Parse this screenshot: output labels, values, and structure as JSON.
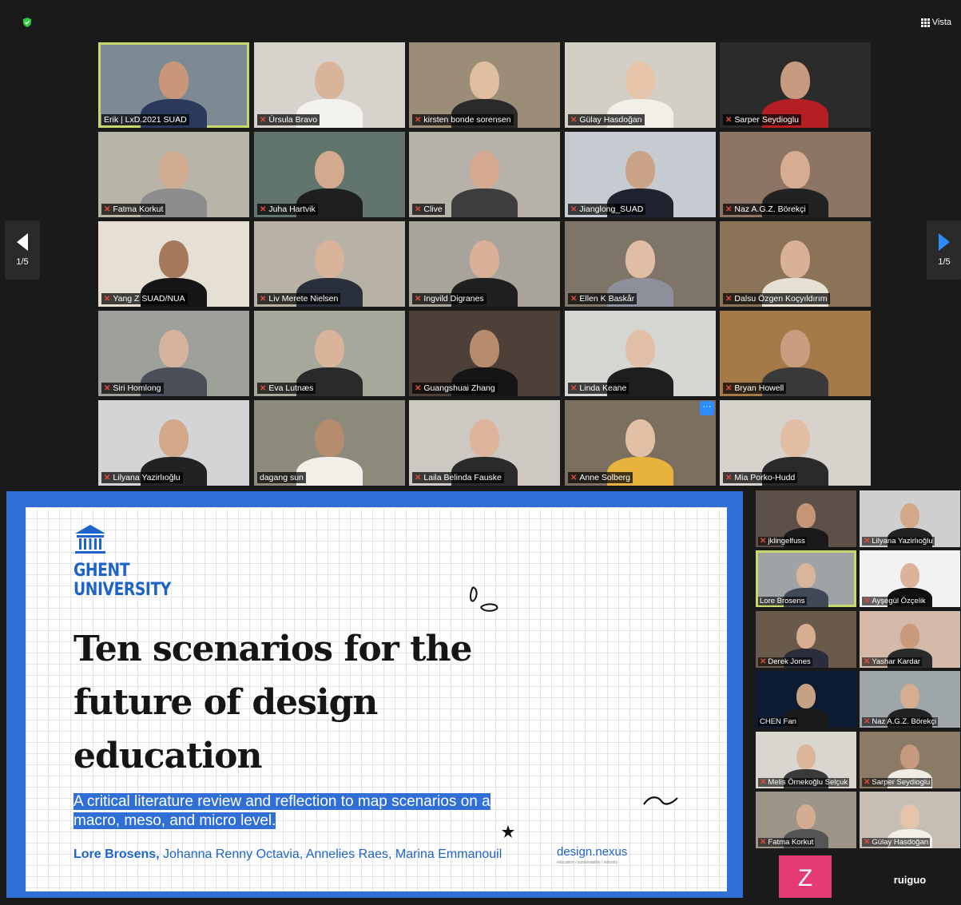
{
  "toolbar": {
    "view_label": "Vista"
  },
  "pagination": {
    "left": "1/5",
    "right": "1/5"
  },
  "gallery": [
    {
      "name": "Erik | LxD.2021 SUAD",
      "muted": false,
      "active": true,
      "bg": "#7e8a93",
      "skin": "#c9967a",
      "shirt": "#2b3a5c"
    },
    {
      "name": "Úrsula Bravo",
      "muted": true,
      "active": false,
      "bg": "#d7d2cc",
      "skin": "#d8b49a",
      "shirt": "#f4f2ef"
    },
    {
      "name": "kirsten bonde sorensen",
      "muted": true,
      "active": false,
      "bg": "#9c8d79",
      "skin": "#e0bfa0",
      "shirt": "#2a2a2a"
    },
    {
      "name": "Gülay Hasdoğan",
      "muted": true,
      "active": false,
      "bg": "#d4cfc5",
      "skin": "#e6c4aa",
      "shirt": "#f2efe9"
    },
    {
      "name": "Sarper Seydioglu",
      "muted": true,
      "active": false,
      "bg": "#2b2b2b",
      "skin": "#c59a7e",
      "shirt": "#b51f24"
    },
    {
      "name": "Fatma Korkut",
      "muted": true,
      "active": false,
      "bg": "#b9b4a8",
      "skin": "#d3ad91",
      "shirt": "#8d8d8d"
    },
    {
      "name": "Juha Hartvik",
      "muted": true,
      "active": false,
      "bg": "#62756d",
      "skin": "#d4aa8f",
      "shirt": "#1f1f1f"
    },
    {
      "name": "Clive",
      "muted": true,
      "active": false,
      "bg": "#b6b1a9",
      "skin": "#d5aa90",
      "shirt": "#3d3d3d"
    },
    {
      "name": "Jianglong_SUAD",
      "muted": true,
      "active": false,
      "bg": "#c5cbd1",
      "skin": "#caa387",
      "shirt": "#1f2330"
    },
    {
      "name": "Naz A.G.Z. Börekçi",
      "muted": true,
      "active": false,
      "bg": "#8d7566",
      "skin": "#d6ad90",
      "shirt": "#222"
    },
    {
      "name": "Yang Z SUAD/NUA",
      "muted": true,
      "active": false,
      "bg": "#e6dfd3",
      "skin": "#a6785c",
      "shirt": "#151515"
    },
    {
      "name": "Liv Merete Nielsen",
      "muted": true,
      "active": false,
      "bg": "#b7b1a6",
      "skin": "#d9b39a",
      "shirt": "#2a2f3c"
    },
    {
      "name": "Ingvild Digranes",
      "muted": true,
      "active": false,
      "bg": "#a8a49b",
      "skin": "#d8b198",
      "shirt": "#202020"
    },
    {
      "name": "Ellen K Baskår",
      "muted": true,
      "active": false,
      "bg": "#7e7568",
      "skin": "#e0bda5",
      "shirt": "#8d8f9a"
    },
    {
      "name": "Dalsu Özgen Koçyıldırım",
      "muted": true,
      "active": false,
      "bg": "#8b7358",
      "skin": "#d9b196",
      "shirt": "#e6e0d5"
    },
    {
      "name": "Siri Homlong",
      "muted": true,
      "active": false,
      "bg": "#9ea19a",
      "skin": "#d6b39c",
      "shirt": "#4a4f5a"
    },
    {
      "name": "Eva Lutnæs",
      "muted": true,
      "active": false,
      "bg": "#a5a89a",
      "skin": "#dab49a",
      "shirt": "#2a2a2a"
    },
    {
      "name": "Guangshuai Zhang",
      "muted": true,
      "active": false,
      "bg": "#4d4038",
      "skin": "#b78b6d",
      "shirt": "#151515"
    },
    {
      "name": "Linda Keane",
      "muted": true,
      "active": false,
      "bg": "#d5d6d2",
      "skin": "#e0bfa6",
      "shirt": "#1e1e1e"
    },
    {
      "name": "Bryan Howell",
      "muted": true,
      "active": false,
      "bg": "#a67a48",
      "skin": "#c99e80",
      "shirt": "#3a3a3a"
    },
    {
      "name": "Lilyana Yazirlıoğlu",
      "muted": true,
      "active": false,
      "bg": "#d3d4d6",
      "skin": "#d2a888",
      "shirt": "#222"
    },
    {
      "name": "dagang sun",
      "muted": false,
      "active": false,
      "bg": "#8b8a7b",
      "skin": "#b68c6f",
      "shirt": "#f1efe8"
    },
    {
      "name": "Laila Belinda Fauske",
      "muted": true,
      "active": false,
      "bg": "#cdc9c2",
      "skin": "#dcb49b",
      "shirt": "#2a2a2a"
    },
    {
      "name": "Anne Solberg",
      "muted": true,
      "active": false,
      "bg": "#7b6f60",
      "skin": "#e1c0a6",
      "shirt": "#e8b33c"
    },
    {
      "name": "Mia Porko-Hudd",
      "muted": true,
      "active": false,
      "bg": "#d7d3cc",
      "skin": "#e0bda3",
      "shirt": "#2a2a2a"
    }
  ],
  "slide": {
    "university_line1": "GHENT",
    "university_line2": "UNIVERSITY",
    "title": "Ten scenarios for the future of design education",
    "subtitle": "A critical literature review and reflection to map scenarios on a macro, meso, and micro level.",
    "author_lead": "Lore Brosens,",
    "authors_rest": " Johanna Renny Octavia, Annelies Raes, Marina Emmanouil",
    "logo_text": "design.nexus",
    "logo_sub": "education / sustainability / industry",
    "accent": "#1e64c8"
  },
  "sidebar": [
    {
      "name": "jklingelfuss",
      "muted": true,
      "active": false,
      "bg": "#5c5048",
      "skin": "#c49577",
      "shirt": "#1a1a1a"
    },
    {
      "name": "Lilyana Yazirlıoğlu",
      "muted": true,
      "active": false,
      "bg": "#cfcfcf",
      "skin": "#d2a888",
      "shirt": "#222"
    },
    {
      "name": "Lore Brosens",
      "muted": false,
      "active": true,
      "bg": "#9fa3a6",
      "skin": "#d9b59c",
      "shirt": "#3f4a56"
    },
    {
      "name": "Ayşegül Özçelik",
      "muted": true,
      "active": false,
      "bg": "#f2f2f2",
      "skin": "#dcb39a",
      "shirt": "#111"
    },
    {
      "name": "Derek Jones",
      "muted": true,
      "active": false,
      "bg": "#6a5a4b",
      "skin": "#d7ae91",
      "shirt": "#2a2e3a"
    },
    {
      "name": "Yashar Kardar",
      "muted": true,
      "active": false,
      "bg": "#d4b9a9",
      "skin": "#c8997a",
      "shirt": "#2a2a2a"
    },
    {
      "name": "CHEN Fan",
      "muted": false,
      "active": false,
      "bg": "#0c1a33",
      "skin": "#c7a184",
      "shirt": "#1a1a1a"
    },
    {
      "name": "Naz A.G.Z. Börekçi",
      "muted": true,
      "active": false,
      "bg": "#9ea6a9",
      "skin": "#d6ad90",
      "shirt": "#222"
    },
    {
      "name": "Melis Örnekoğlu Selçuk",
      "muted": true,
      "active": false,
      "bg": "#d9d6d0",
      "skin": "#ddb59a",
      "shirt": "#3a3a3a"
    },
    {
      "name": "Sarper Seydioglu",
      "muted": true,
      "active": false,
      "bg": "#8a7a66",
      "skin": "#c59a7e",
      "shirt": "#f0ece4"
    },
    {
      "name": "Fatma Korkut",
      "muted": true,
      "active": false,
      "bg": "#9d9588",
      "skin": "#d3ad91",
      "shirt": "#555"
    },
    {
      "name": "Gülay Hasdoğan",
      "muted": true,
      "active": false,
      "bg": "#c7bfb4",
      "skin": "#e6c4aa",
      "shirt": "#f2efe9"
    }
  ],
  "bottom_tiles": {
    "z_initial": "Z",
    "ruiguo": "ruiguo"
  }
}
